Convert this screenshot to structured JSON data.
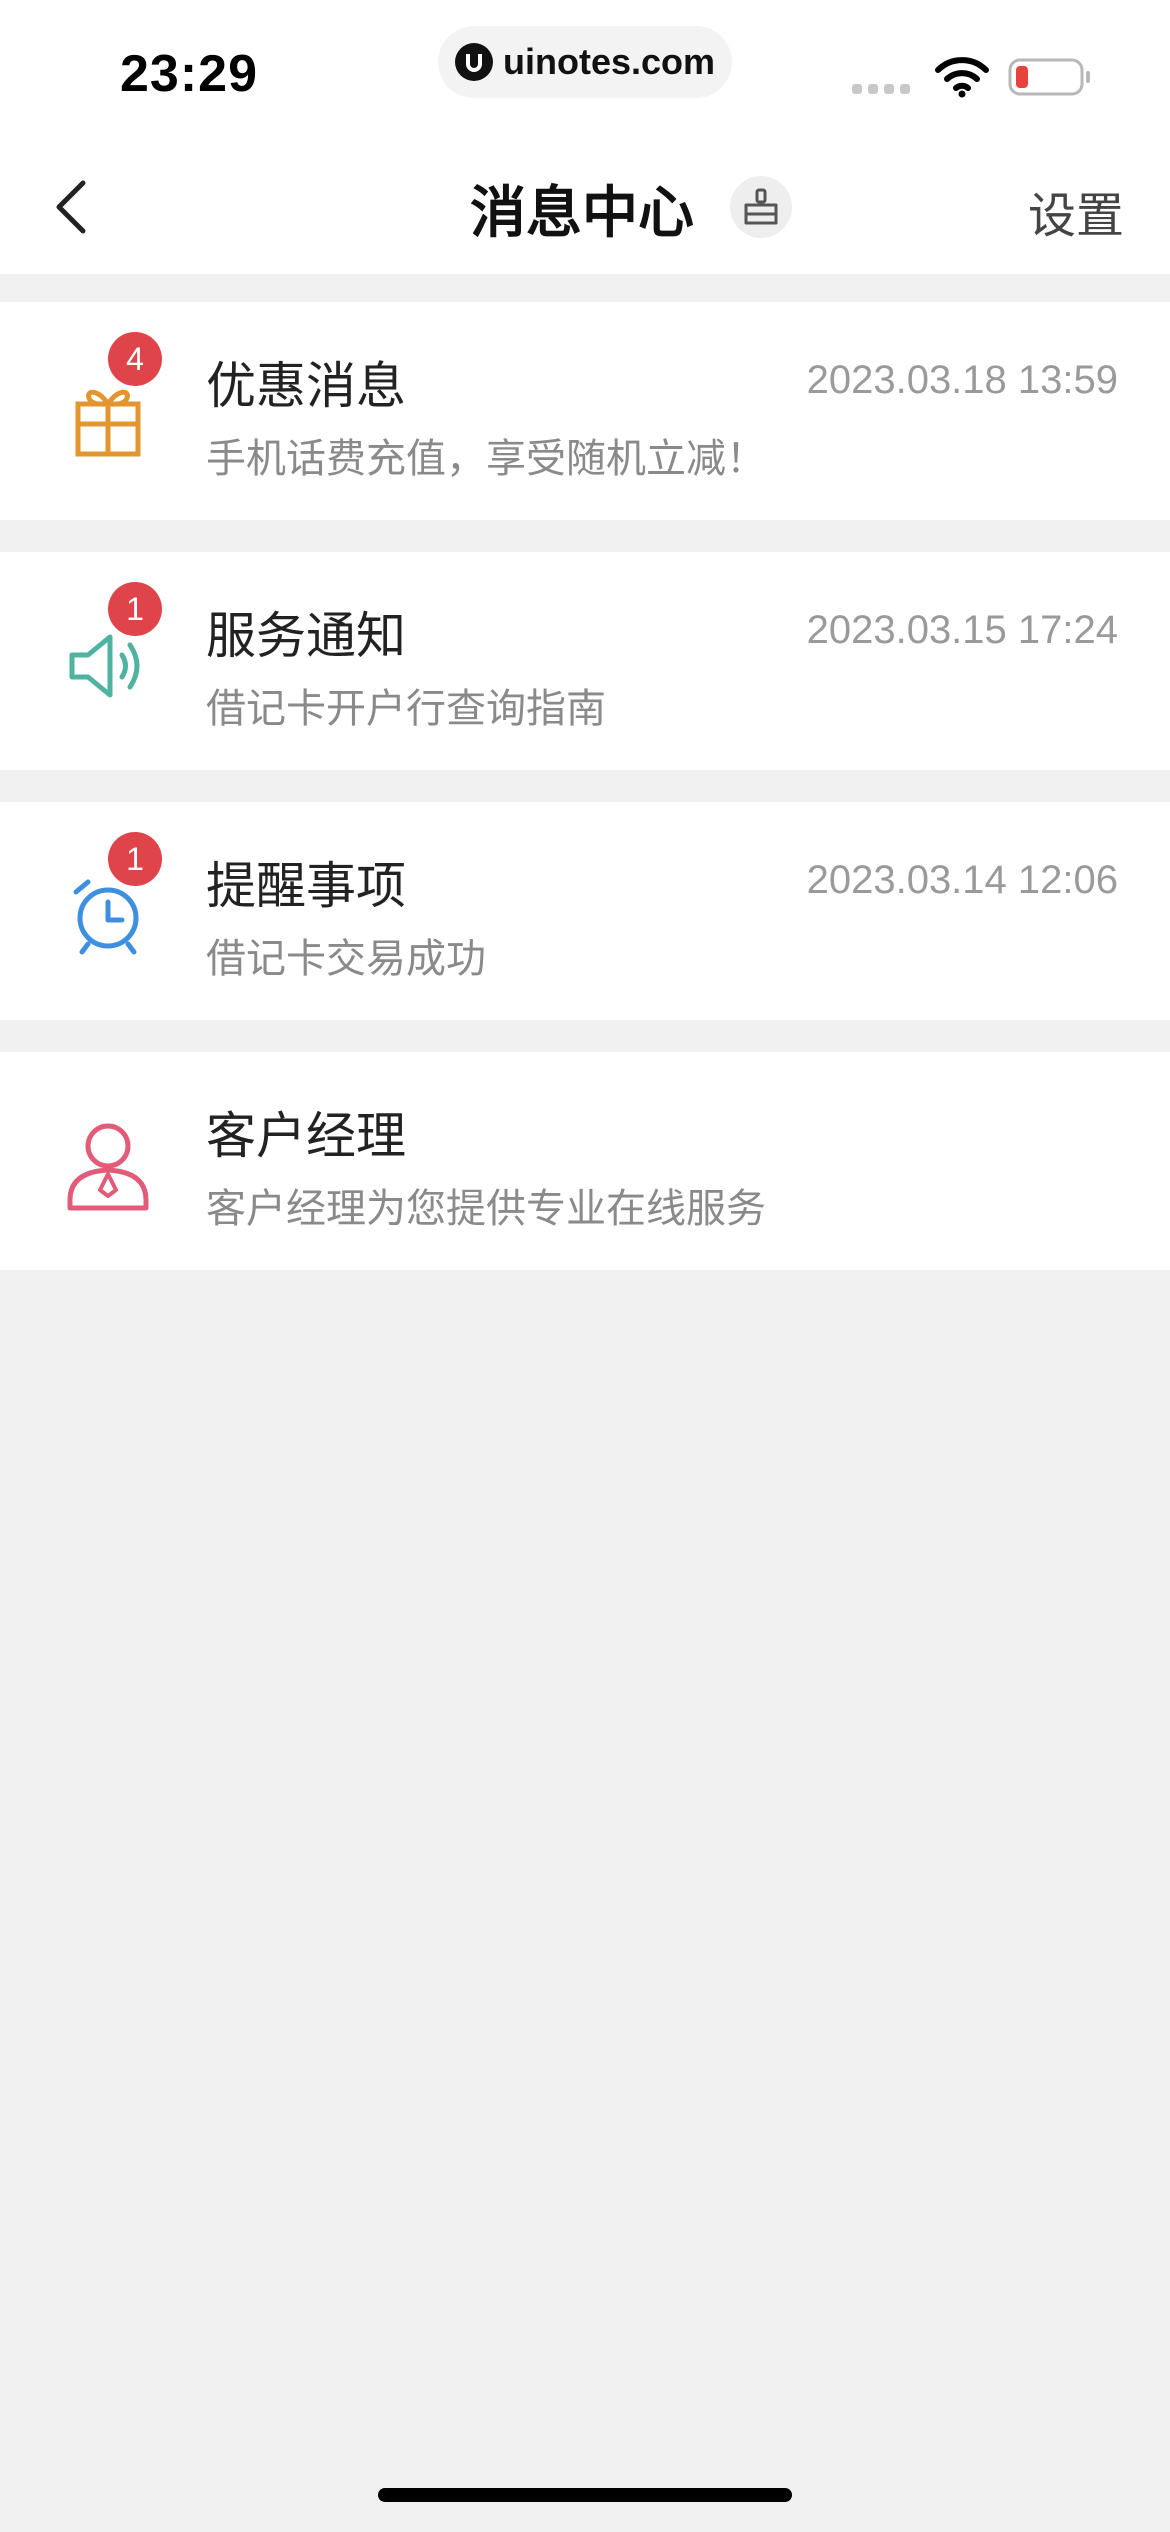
{
  "status_bar": {
    "time": "23:29",
    "url": "uinotes.com"
  },
  "header": {
    "title": "消息中心",
    "settings_label": "设置",
    "back_icon": "chevron-left-icon",
    "clean_icon": "broom-icon"
  },
  "messages": [
    {
      "title": "优惠消息",
      "subtitle": "手机话费充值，享受随机立减！",
      "time": "2023.03.18 13:59",
      "badge": "4",
      "icon": "gift-icon",
      "color": "#e3962f"
    },
    {
      "title": "服务通知",
      "subtitle": "借记卡开户行查询指南",
      "time": "2023.03.15 17:24",
      "badge": "1",
      "icon": "speaker-icon",
      "color": "#4fb3a0"
    },
    {
      "title": "提醒事项",
      "subtitle": "借记卡交易成功",
      "time": "2023.03.14 12:06",
      "badge": "1",
      "icon": "alarm-clock-icon",
      "color": "#3f8fe0"
    },
    {
      "title": "客户经理",
      "subtitle": "客户经理为您提供专业在线服务",
      "icon": "manager-icon",
      "color": "#e25b78"
    }
  ],
  "colors": {
    "badge": "#e0444b",
    "background": "#f0f0f0"
  }
}
